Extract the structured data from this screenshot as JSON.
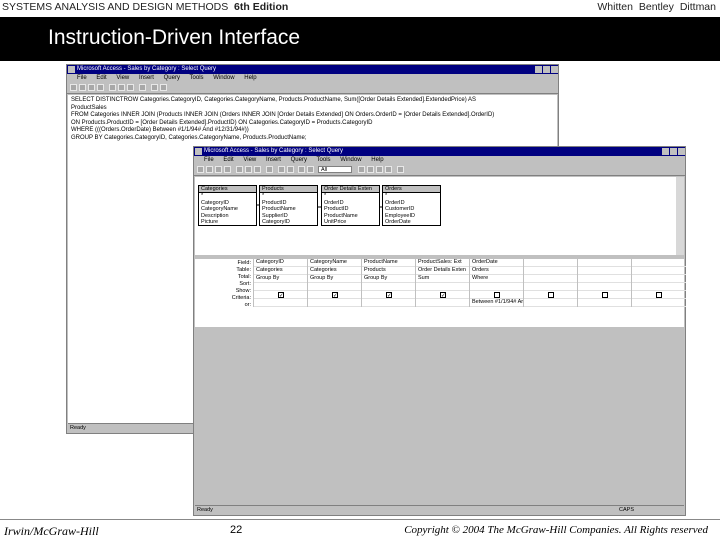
{
  "header": {
    "book_title": "SYSTEMS ANALYSIS AND DESIGN METHODS",
    "edition": "6th Edition",
    "authors": "Whitten  Bentley  Dittman"
  },
  "slide_title": "Instruction-Driven Interface",
  "back_window": {
    "title": "Microsoft Access - Sales by Category : Select Query",
    "menu": [
      "File",
      "Edit",
      "View",
      "Insert",
      "Query",
      "Tools",
      "Window",
      "Help"
    ],
    "sql_lines": [
      "SELECT DISTINCTROW Categories.CategoryID, Categories.CategoryName, Products.ProductName, Sum([Order Details Extended].ExtendedPrice) AS",
      "ProductSales",
      "FROM Categories INNER JOIN (Products INNER JOIN (Orders INNER JOIN [Order Details Extended] ON Orders.OrderID = [Order Details Extended].OrderID)",
      "ON Products.ProductID = [Order Details Extended].ProductID) ON Categories.CategoryID = Products.CategoryID",
      "WHERE (((Orders.OrderDate) Between #1/1/94# And #12/31/94#))",
      "GROUP BY Categories.CategoryID, Categories.CategoryName, Products.ProductName;"
    ],
    "status": "Ready"
  },
  "front_window": {
    "title": "Microsoft Access - Sales by Category : Select Query",
    "menu": [
      "File",
      "Edit",
      "View",
      "Insert",
      "Query",
      "Tools",
      "Window",
      "Help"
    ],
    "toolbar_combo": "All",
    "tables": [
      {
        "name": "Categories",
        "fields": [
          "*",
          "CategoryID",
          "CategoryName",
          "Description",
          "Picture"
        ]
      },
      {
        "name": "Products",
        "fields": [
          "*",
          "ProductID",
          "ProductName",
          "SupplierID",
          "CategoryID"
        ]
      },
      {
        "name": "Order Details Exten",
        "fields": [
          "*",
          "OrderID",
          "ProductID",
          "ProductName",
          "UnitPrice"
        ]
      },
      {
        "name": "Orders",
        "fields": [
          "*",
          "OrderID",
          "CustomerID",
          "EmployeeID",
          "OrderDate"
        ]
      }
    ],
    "grid_row_labels": [
      "Field:",
      "Table:",
      "Total:",
      "Sort:",
      "Show:",
      "Criteria:",
      "or:"
    ],
    "grid_columns": [
      {
        "field": "CategoryID",
        "table": "Categories",
        "total": "Group By",
        "show": true,
        "criteria": ""
      },
      {
        "field": "CategoryName",
        "table": "Categories",
        "total": "Group By",
        "show": true,
        "criteria": ""
      },
      {
        "field": "ProductName",
        "table": "Products",
        "total": "Group By",
        "show": true,
        "criteria": ""
      },
      {
        "field": "ProductSales: Ext",
        "table": "Order Details Exten",
        "total": "Sum",
        "show": true,
        "criteria": ""
      },
      {
        "field": "OrderDate",
        "table": "Orders",
        "total": "Where",
        "show": false,
        "criteria": "Between #1/1/94# An"
      },
      {
        "field": "",
        "table": "",
        "total": "",
        "show": false,
        "criteria": ""
      },
      {
        "field": "",
        "table": "",
        "total": "",
        "show": false,
        "criteria": ""
      },
      {
        "field": "",
        "table": "",
        "total": "",
        "show": false,
        "criteria": ""
      }
    ],
    "status": "Ready",
    "status_right": "CAPS"
  },
  "footer": {
    "publisher": "Irwin/McGraw-Hill",
    "page_number": "22",
    "copyright": "Copyright © 2004 The McGraw-Hill Companies. All Rights reserved"
  }
}
